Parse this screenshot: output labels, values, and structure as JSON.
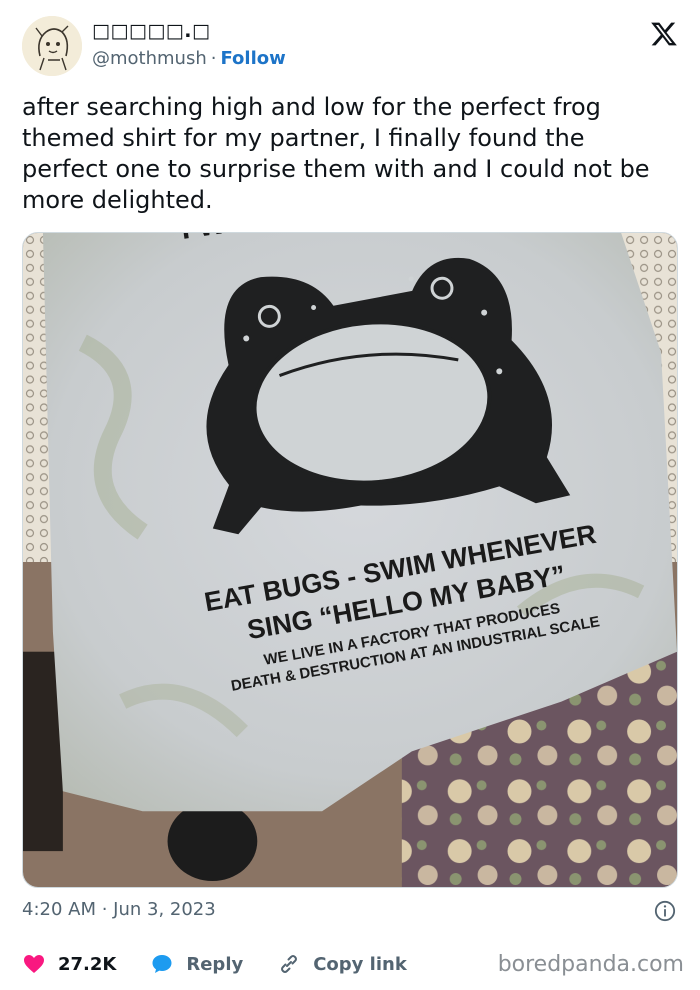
{
  "author": {
    "display_name": "□□□□□.□",
    "handle": "@mothmush",
    "separator": "·",
    "follow_label": "Follow"
  },
  "tweet": {
    "text": "after searching high and low for the perfect frog themed shirt for my partner, I finally found the perfect one to surprise them with and I could not be more delighted."
  },
  "media": {
    "shirt_text": {
      "top_partial": "I WAN",
      "line1": "EAT BUGS - SWIM WHENEVER",
      "line2": "SING “HELLO MY BABY”",
      "line3": "WE LIVE IN A FACTORY THAT PRODUCES",
      "line4": "DEATH & DESTRUCTION AT AN INDUSTRIAL SCALE"
    }
  },
  "meta": {
    "timestamp": "4:20 AM · Jun 3, 2023"
  },
  "actions": {
    "likes": "27.2K",
    "reply_label": "Reply",
    "copy_link_label": "Copy link"
  },
  "watermark": "boredpanda.com",
  "colors": {
    "like": "#f91880",
    "reply": "#1d9bf0",
    "link": "#1d74c8",
    "muted": "#536471"
  },
  "icons": [
    "avatar-sketch",
    "x-logo-icon",
    "info-icon",
    "heart-icon",
    "reply-bubble-icon",
    "link-icon"
  ]
}
